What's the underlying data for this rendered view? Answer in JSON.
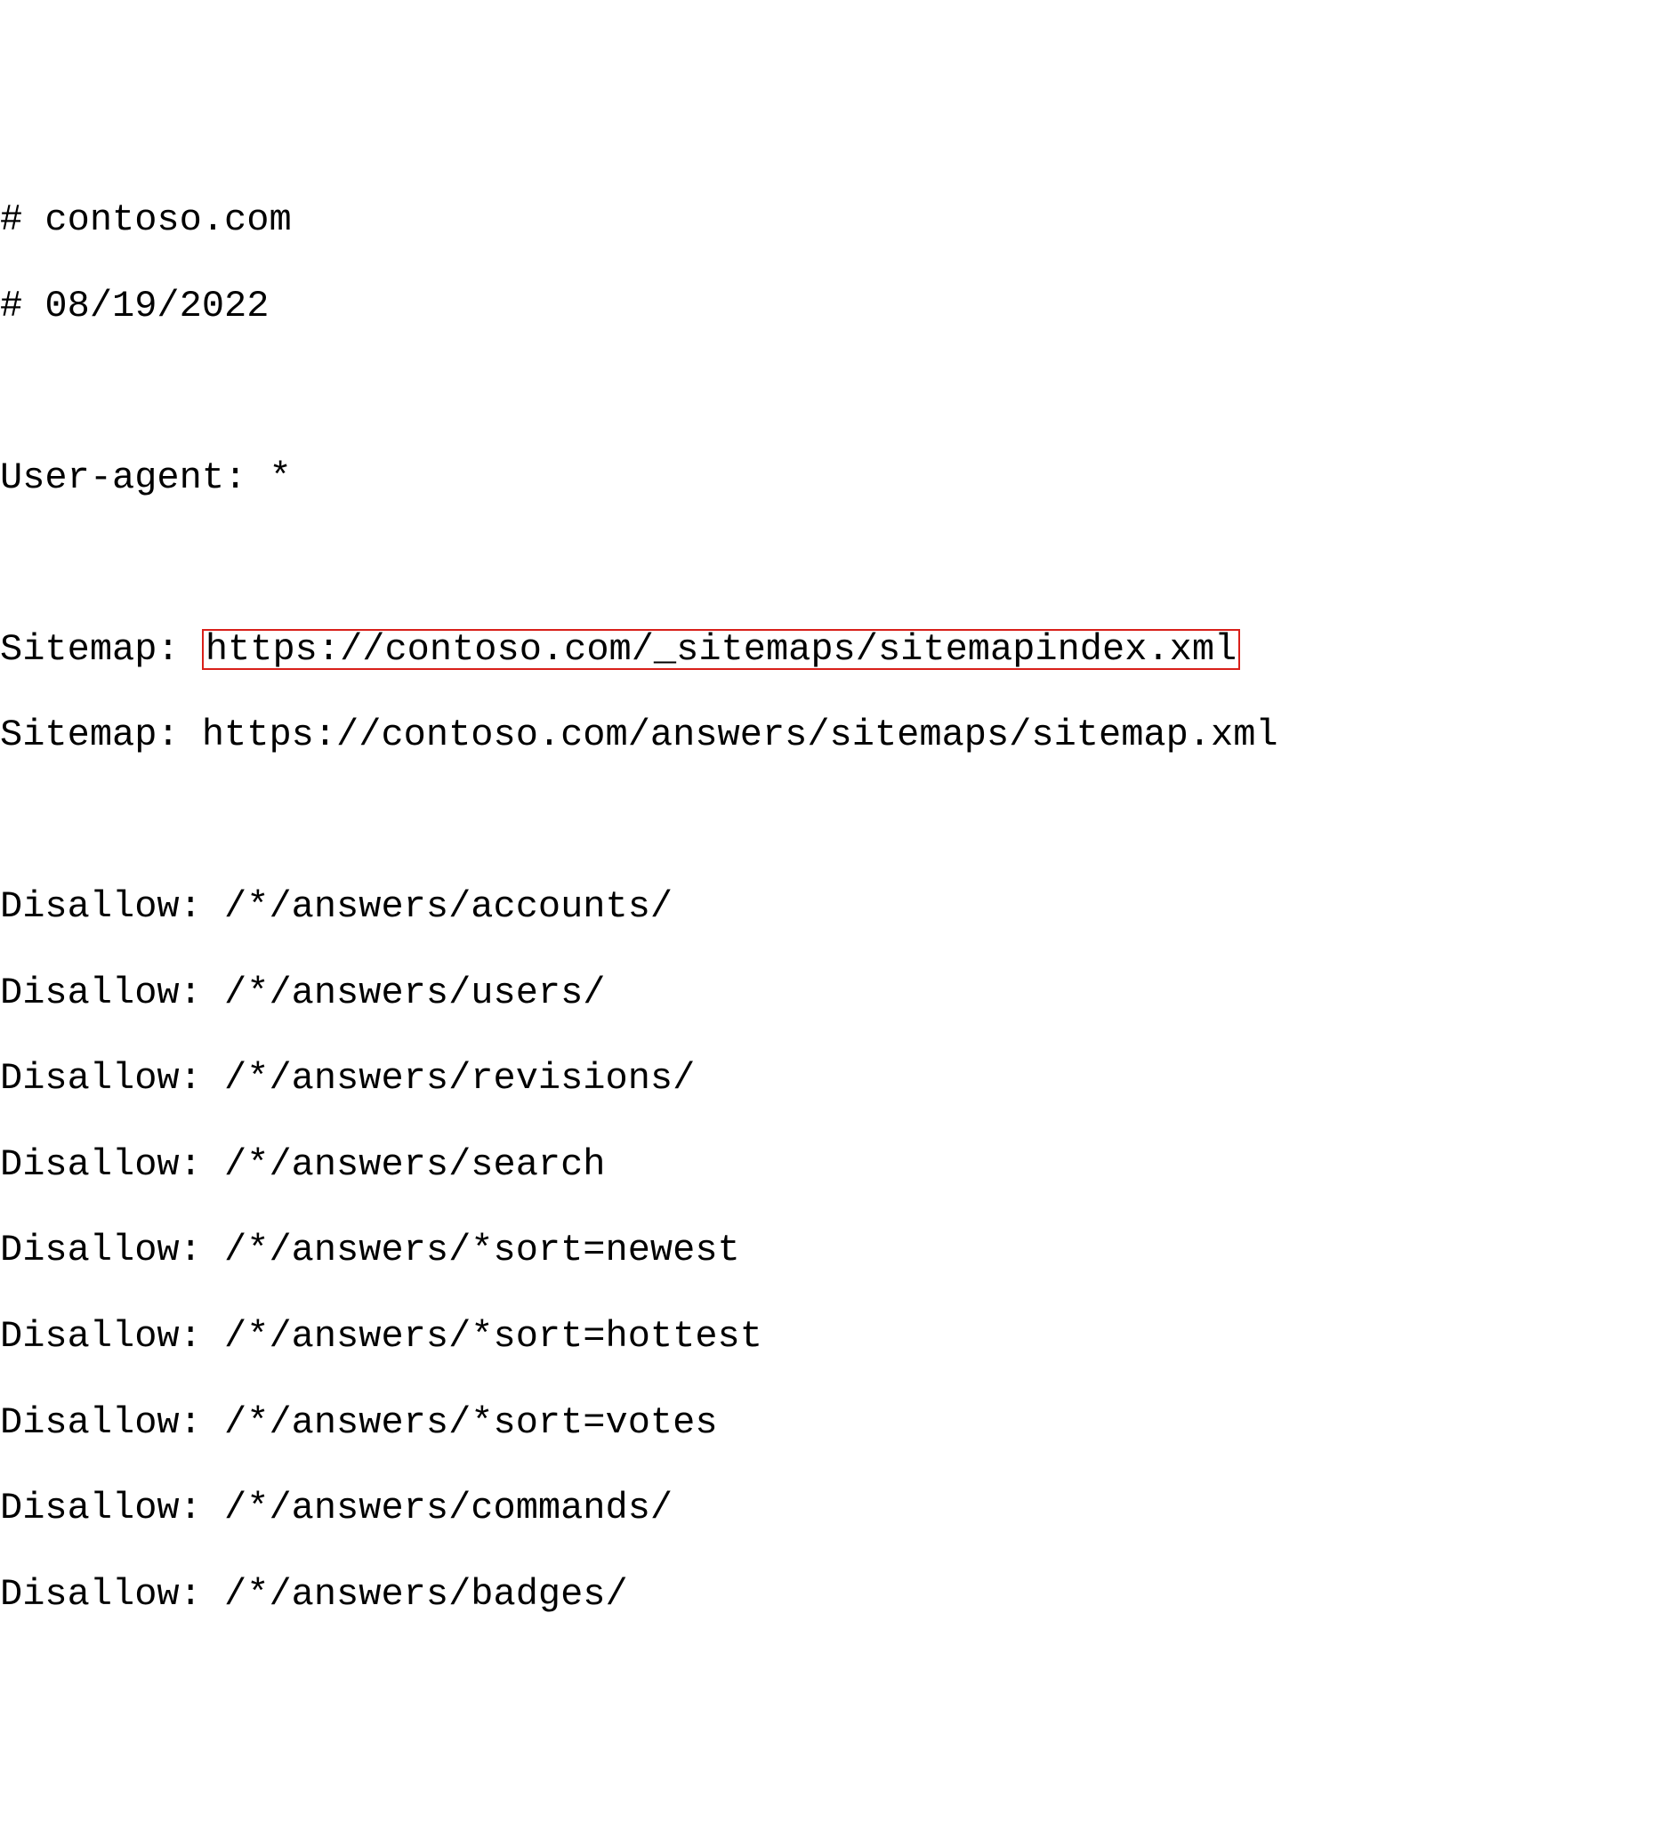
{
  "lines": {
    "comment_domain": "# contoso.com",
    "comment_date": "# 08/19/2022",
    "user_agent": "User-agent: *",
    "sitemap1_label": "Sitemap: ",
    "sitemap1_url": "https://contoso.com/_sitemaps/sitemapindex.xml",
    "sitemap2": "Sitemap: https://contoso.com/answers/sitemaps/sitemap.xml",
    "disallow1": "Disallow: /*/answers/accounts/",
    "disallow2": "Disallow: /*/answers/users/",
    "disallow3": "Disallow: /*/answers/revisions/",
    "disallow4": "Disallow: /*/answers/search",
    "disallow5": "Disallow: /*/answers/*sort=newest",
    "disallow6": "Disallow: /*/answers/*sort=hottest",
    "disallow7": "Disallow: /*/answers/*sort=votes",
    "disallow8": "Disallow: /*/answers/commands/",
    "disallow9": "Disallow: /*/answers/badges/"
  },
  "highlight_color": "#d9201a"
}
